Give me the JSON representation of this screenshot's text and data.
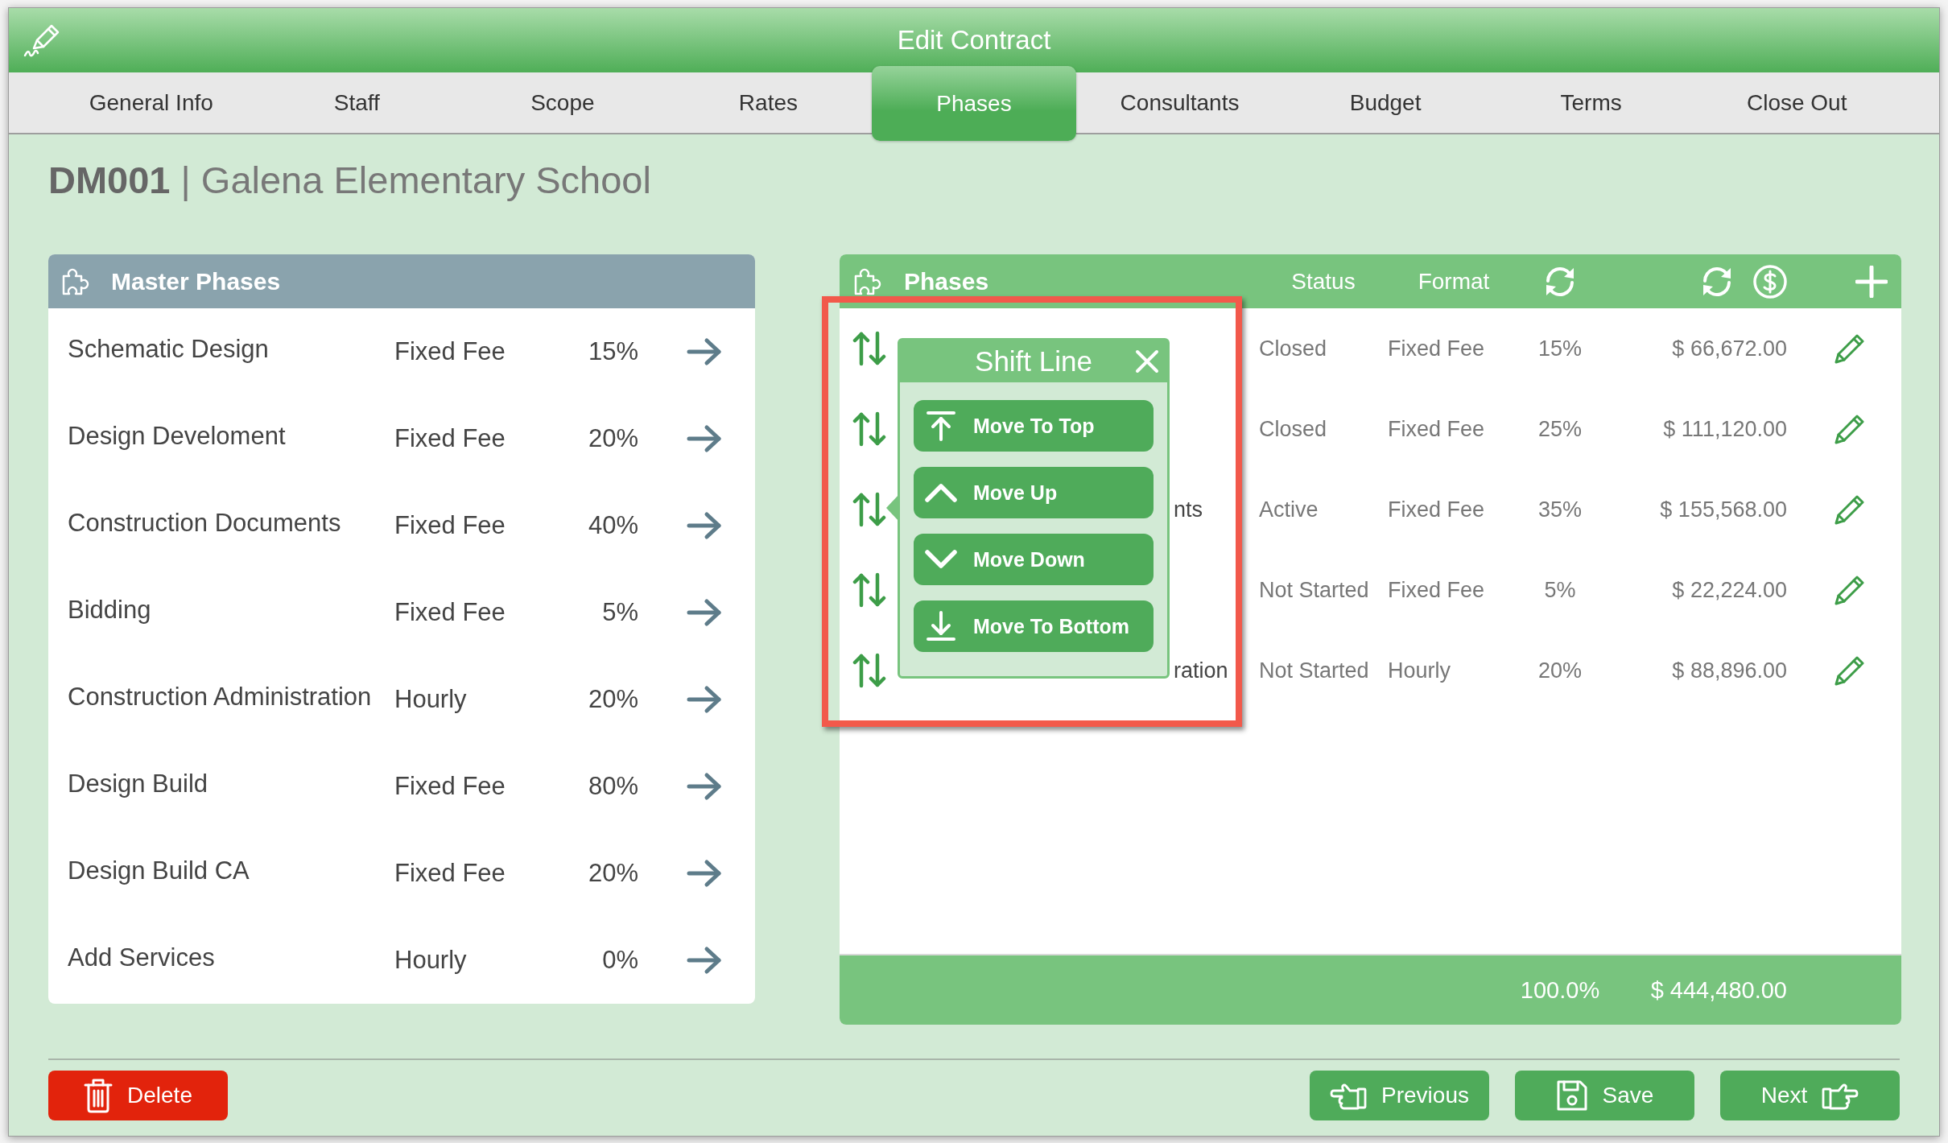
{
  "window": {
    "title": "Edit Contract"
  },
  "tabs": [
    {
      "label": "General Info",
      "selected": false
    },
    {
      "label": "Staff",
      "selected": false
    },
    {
      "label": "Scope",
      "selected": false
    },
    {
      "label": "Rates",
      "selected": false
    },
    {
      "label": "Phases",
      "selected": true
    },
    {
      "label": "Consultants",
      "selected": false
    },
    {
      "label": "Budget",
      "selected": false
    },
    {
      "label": "Terms",
      "selected": false
    },
    {
      "label": "Close Out",
      "selected": false
    }
  ],
  "heading": "**DM001** | Galena Elementary School",
  "master_phases": {
    "title": "Master Phases",
    "rows": [
      {
        "name": "Schematic Design",
        "format": "Fixed Fee",
        "percent": "15%"
      },
      {
        "name": "Design Develoment",
        "format": "Fixed Fee",
        "percent": "20%"
      },
      {
        "name": "Construction Documents",
        "format": "Fixed Fee",
        "percent": "40%"
      },
      {
        "name": "Bidding",
        "format": "Fixed Fee",
        "percent": "5%"
      },
      {
        "name": "Construction Administration",
        "format": "Hourly",
        "percent": "20%"
      },
      {
        "name": "Design Build",
        "format": "Fixed Fee",
        "percent": "80%"
      },
      {
        "name": "Design Build CA",
        "format": "Fixed Fee",
        "percent": "20%"
      },
      {
        "name": "Add Services",
        "format": "Hourly",
        "percent": "0%"
      }
    ]
  },
  "phases": {
    "title": "Phases",
    "columns": [
      "Status",
      "Format"
    ],
    "rows": [
      {
        "status": "Closed",
        "format": "Fixed Fee",
        "percent": "15%",
        "amount": "$ 66,672.00"
      },
      {
        "status": "Closed",
        "format": "Fixed Fee",
        "percent": "25%",
        "amount": "$ 111,120.00"
      },
      {
        "name": "nts",
        "status": "Active",
        "format": "Fixed Fee",
        "percent": "35%",
        "amount": "$ 155,568.00"
      },
      {
        "status": "Not Started",
        "format": "Fixed Fee",
        "percent": "5%",
        "amount": "$ 22,224.00"
      },
      {
        "name": "ration",
        "status": "Not Started",
        "format": "Hourly",
        "percent": "20%",
        "amount": "$ 88,896.00"
      }
    ],
    "totals": {
      "percent": "100.0%",
      "amount": "$ 444,480.00"
    }
  },
  "shift_line_popup": {
    "title": "Shift Line",
    "actions": [
      {
        "label": "Move To Top",
        "kind": "top"
      },
      {
        "label": "Move Up",
        "kind": "up"
      },
      {
        "label": "Move Down",
        "kind": "down"
      },
      {
        "label": "Move To Bottom",
        "kind": "bottom"
      }
    ]
  },
  "buttons": [
    {
      "label": "Delete",
      "kind": "delete"
    },
    {
      "label": "Previous",
      "kind": "previous"
    },
    {
      "label": "Save",
      "kind": "save"
    },
    {
      "label": "Next",
      "kind": "next"
    }
  ]
}
